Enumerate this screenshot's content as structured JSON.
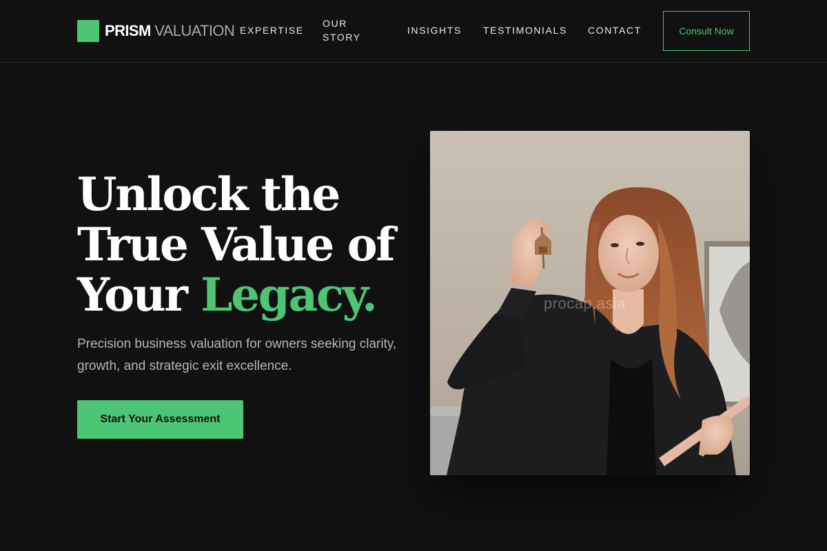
{
  "brand": {
    "name_bold": "PRISM",
    "name_light": "VALUATION",
    "accent_color": "#4cc674"
  },
  "nav": {
    "expertise": "EXPERTISE",
    "our_story": "OUR STORY",
    "insights": "INSIGHTS",
    "testimonials": "TESTIMONIALS",
    "contact": "CONTACT",
    "consult": "Consult Now"
  },
  "hero": {
    "title_line1": "Unlock the",
    "title_line2": "True Value of",
    "title_line3a": "Your ",
    "title_accent": "Legacy.",
    "subtitle": "Precision business valuation for owners seeking clarity, growth, and strategic exit excellence.",
    "cta_label": "Start Your Assessment"
  },
  "photo": {
    "watermark": "procap.asia",
    "description_icon": "woman-holding-keys-photo"
  }
}
